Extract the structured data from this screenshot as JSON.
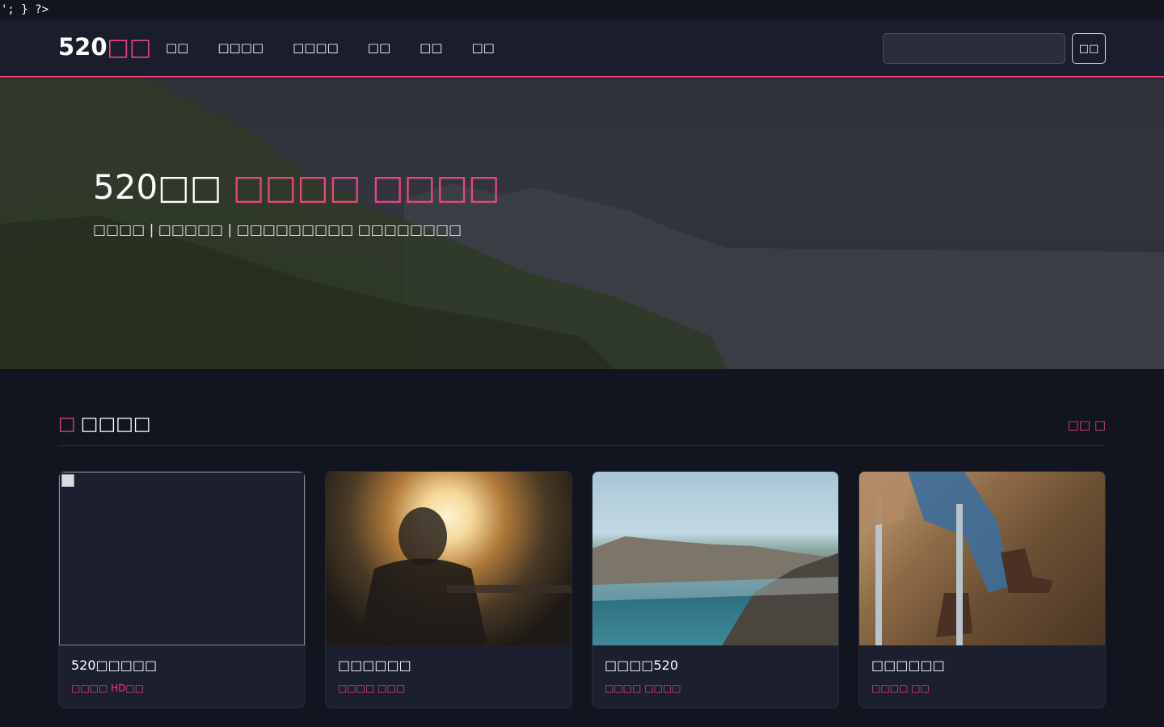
{
  "topline": "'; } ?>",
  "brand": {
    "name": "520",
    "accent": "□□"
  },
  "nav": [
    "□□",
    "□□□□",
    "□□□□",
    "□□",
    "□□",
    "□□"
  ],
  "search": {
    "placeholder": "",
    "button_label": "□□"
  },
  "hero": {
    "title": "520□□",
    "title_accent": "□□□□ □□□□",
    "subtitle": "□□□□ | □□□□□ | □□□□□□□□□ □□□□□□□□"
  },
  "section": {
    "icon": "□",
    "title": "□□□□",
    "more_label": "□□ □"
  },
  "cards": [
    {
      "title": "520□□□□□",
      "meta": "□□□□ HD□□",
      "image": "broken-image"
    },
    {
      "title": "□□□□□□",
      "meta": "□□□□ □□□",
      "image": "sunset-person"
    },
    {
      "title": "□□□□520",
      "meta": "□□□□ □□□□",
      "image": "rocky-coast"
    },
    {
      "title": "□□□□□□",
      "meta": "□□□□ □□",
      "image": "boots-stool"
    }
  ],
  "colors": {
    "accent": "#e8457d",
    "navbar_bg": "#1a1d2b",
    "page_bg": "#12141f",
    "card_bg": "#1c1f2d"
  }
}
